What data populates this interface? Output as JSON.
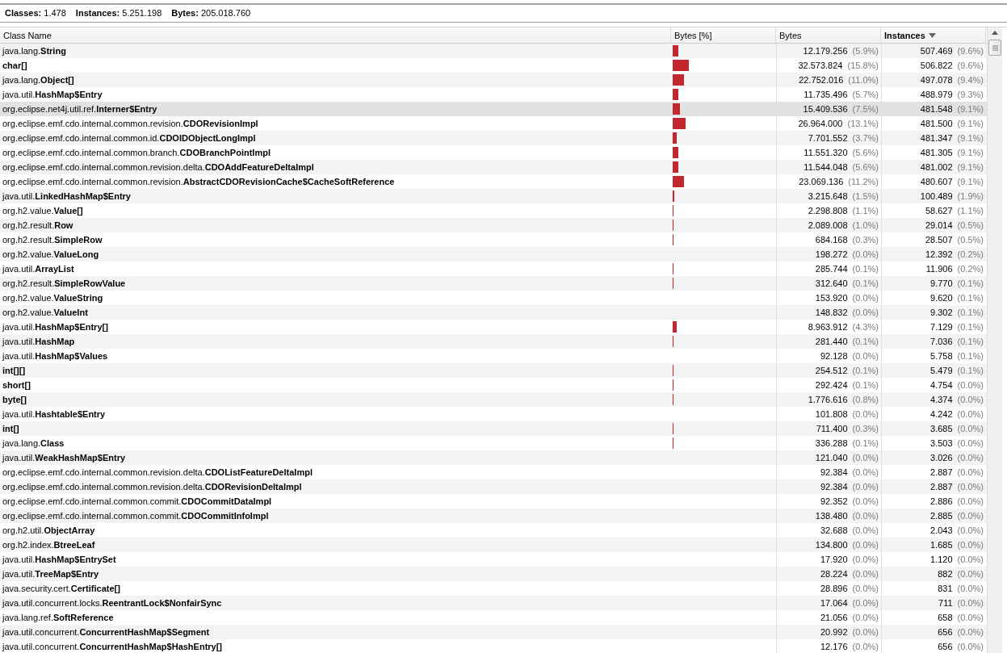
{
  "summary": [
    {
      "label": "Classes:",
      "value": "1.478"
    },
    {
      "label": "Instances:",
      "value": "5.251.198"
    },
    {
      "label": "Bytes:",
      "value": "205.018.760"
    }
  ],
  "table": {
    "columns": [
      {
        "label": "Class Name",
        "sorted": false,
        "kind": "name"
      },
      {
        "label": "Bytes [%]",
        "sorted": false,
        "kind": "bar"
      },
      {
        "label": "Bytes",
        "sorted": false,
        "kind": "bytes"
      },
      {
        "label": "Instances",
        "sorted": true,
        "kind": "instances"
      }
    ],
    "rows": [
      {
        "package": "java.lang.",
        "class": "String",
        "bytes": "12.179.256",
        "bytes_pct": "(5.9%)",
        "instances": "507.469",
        "instances_pct": "(9.6%)",
        "selected": false
      },
      {
        "package": "",
        "class": "char[]",
        "bytes": "32.573.824",
        "bytes_pct": "(15.8%)",
        "instances": "506.822",
        "instances_pct": "(9.6%)",
        "selected": false
      },
      {
        "package": "java.lang.",
        "class": "Object[]",
        "bytes": "22.752.016",
        "bytes_pct": "(11.0%)",
        "instances": "497.078",
        "instances_pct": "(9.4%)",
        "selected": false
      },
      {
        "package": "java.util.",
        "class": "HashMap$Entry",
        "bytes": "11.735.496",
        "bytes_pct": "(5.7%)",
        "instances": "488.979",
        "instances_pct": "(9.3%)",
        "selected": false
      },
      {
        "package": "org.eclipse.net4j.util.ref.",
        "class": "Interner$Entry",
        "bytes": "15.409.536",
        "bytes_pct": "(7.5%)",
        "instances": "481.548",
        "instances_pct": "(9.1%)",
        "selected": true
      },
      {
        "package": "org.eclipse.emf.cdo.internal.common.revision.",
        "class": "CDORevisionImpl",
        "bytes": "26.964.000",
        "bytes_pct": "(13.1%)",
        "instances": "481.500",
        "instances_pct": "(9.1%)",
        "selected": false
      },
      {
        "package": "org.eclipse.emf.cdo.internal.common.id.",
        "class": "CDOIDObjectLongImpl",
        "bytes": "7.701.552",
        "bytes_pct": "(3.7%)",
        "instances": "481.347",
        "instances_pct": "(9.1%)",
        "selected": false
      },
      {
        "package": "org.eclipse.emf.cdo.internal.common.branch.",
        "class": "CDOBranchPointImpl",
        "bytes": "11.551.320",
        "bytes_pct": "(5.6%)",
        "instances": "481.305",
        "instances_pct": "(9.1%)",
        "selected": false
      },
      {
        "package": "org.eclipse.emf.cdo.internal.common.revision.delta.",
        "class": "CDOAddFeatureDeltaImpl",
        "bytes": "11.544.048",
        "bytes_pct": "(5.6%)",
        "instances": "481.002",
        "instances_pct": "(9.1%)",
        "selected": false
      },
      {
        "package": "org.eclipse.emf.cdo.internal.common.revision.",
        "class": "AbstractCDORevisionCache$CacheSoftReference",
        "bytes": "23.069.136",
        "bytes_pct": "(11.2%)",
        "instances": "480.607",
        "instances_pct": "(9.1%)",
        "selected": false
      },
      {
        "package": "java.util.",
        "class": "LinkedHashMap$Entry",
        "bytes": "3.215.648",
        "bytes_pct": "(1.5%)",
        "instances": "100.489",
        "instances_pct": "(1.9%)",
        "selected": false
      },
      {
        "package": "org.h2.value.",
        "class": "Value[]",
        "bytes": "2.298.808",
        "bytes_pct": "(1.1%)",
        "instances": "58.627",
        "instances_pct": "(1.1%)",
        "selected": false
      },
      {
        "package": "org.h2.result.",
        "class": "Row",
        "bytes": "2.089.008",
        "bytes_pct": "(1.0%)",
        "instances": "29.014",
        "instances_pct": "(0.5%)",
        "selected": false
      },
      {
        "package": "org.h2.result.",
        "class": "SimpleRow",
        "bytes": "684.168",
        "bytes_pct": "(0.3%)",
        "instances": "28.507",
        "instances_pct": "(0.5%)",
        "selected": false
      },
      {
        "package": "org.h2.value.",
        "class": "ValueLong",
        "bytes": "198.272",
        "bytes_pct": "(0.0%)",
        "instances": "12.392",
        "instances_pct": "(0.2%)",
        "selected": false
      },
      {
        "package": "java.util.",
        "class": "ArrayList",
        "bytes": "285.744",
        "bytes_pct": "(0.1%)",
        "instances": "11.906",
        "instances_pct": "(0.2%)",
        "selected": false
      },
      {
        "package": "org.h2.result.",
        "class": "SimpleRowValue",
        "bytes": "312.640",
        "bytes_pct": "(0.1%)",
        "instances": "9.770",
        "instances_pct": "(0.1%)",
        "selected": false
      },
      {
        "package": "org.h2.value.",
        "class": "ValueString",
        "bytes": "153.920",
        "bytes_pct": "(0.0%)",
        "instances": "9.620",
        "instances_pct": "(0.1%)",
        "selected": false
      },
      {
        "package": "org.h2.value.",
        "class": "ValueInt",
        "bytes": "148.832",
        "bytes_pct": "(0.0%)",
        "instances": "9.302",
        "instances_pct": "(0.1%)",
        "selected": false
      },
      {
        "package": "java.util.",
        "class": "HashMap$Entry[]",
        "bytes": "8.963.912",
        "bytes_pct": "(4.3%)",
        "instances": "7.129",
        "instances_pct": "(0.1%)",
        "selected": false
      },
      {
        "package": "java.util.",
        "class": "HashMap",
        "bytes": "281.440",
        "bytes_pct": "(0.1%)",
        "instances": "7.036",
        "instances_pct": "(0.1%)",
        "selected": false
      },
      {
        "package": "java.util.",
        "class": "HashMap$Values",
        "bytes": "92.128",
        "bytes_pct": "(0.0%)",
        "instances": "5.758",
        "instances_pct": "(0.1%)",
        "selected": false
      },
      {
        "package": "",
        "class": "int[][]",
        "bytes": "254.512",
        "bytes_pct": "(0.1%)",
        "instances": "5.479",
        "instances_pct": "(0.1%)",
        "selected": false
      },
      {
        "package": "",
        "class": "short[]",
        "bytes": "292.424",
        "bytes_pct": "(0.1%)",
        "instances": "4.754",
        "instances_pct": "(0.0%)",
        "selected": false
      },
      {
        "package": "",
        "class": "byte[]",
        "bytes": "1.776.616",
        "bytes_pct": "(0.8%)",
        "instances": "4.374",
        "instances_pct": "(0.0%)",
        "selected": false
      },
      {
        "package": "java.util.",
        "class": "Hashtable$Entry",
        "bytes": "101.808",
        "bytes_pct": "(0.0%)",
        "instances": "4.242",
        "instances_pct": "(0.0%)",
        "selected": false
      },
      {
        "package": "",
        "class": "int[]",
        "bytes": "711.400",
        "bytes_pct": "(0.3%)",
        "instances": "3.685",
        "instances_pct": "(0.0%)",
        "selected": false
      },
      {
        "package": "java.lang.",
        "class": "Class",
        "bytes": "336.288",
        "bytes_pct": "(0.1%)",
        "instances": "3.503",
        "instances_pct": "(0.0%)",
        "selected": false
      },
      {
        "package": "java.util.",
        "class": "WeakHashMap$Entry",
        "bytes": "121.040",
        "bytes_pct": "(0.0%)",
        "instances": "3.026",
        "instances_pct": "(0.0%)",
        "selected": false
      },
      {
        "package": "org.eclipse.emf.cdo.internal.common.revision.delta.",
        "class": "CDOListFeatureDeltaImpl",
        "bytes": "92.384",
        "bytes_pct": "(0.0%)",
        "instances": "2.887",
        "instances_pct": "(0.0%)",
        "selected": false
      },
      {
        "package": "org.eclipse.emf.cdo.internal.common.revision.delta.",
        "class": "CDORevisionDeltaImpl",
        "bytes": "92.384",
        "bytes_pct": "(0.0%)",
        "instances": "2.887",
        "instances_pct": "(0.0%)",
        "selected": false
      },
      {
        "package": "org.eclipse.emf.cdo.internal.common.commit.",
        "class": "CDOCommitDataImpl",
        "bytes": "92.352",
        "bytes_pct": "(0.0%)",
        "instances": "2.886",
        "instances_pct": "(0.0%)",
        "selected": false
      },
      {
        "package": "org.eclipse.emf.cdo.internal.common.commit.",
        "class": "CDOCommitInfoImpl",
        "bytes": "138.480",
        "bytes_pct": "(0.0%)",
        "instances": "2.885",
        "instances_pct": "(0.0%)",
        "selected": false
      },
      {
        "package": "org.h2.util.",
        "class": "ObjectArray",
        "bytes": "32.688",
        "bytes_pct": "(0.0%)",
        "instances": "2.043",
        "instances_pct": "(0.0%)",
        "selected": false
      },
      {
        "package": "org.h2.index.",
        "class": "BtreeLeaf",
        "bytes": "134.800",
        "bytes_pct": "(0.0%)",
        "instances": "1.685",
        "instances_pct": "(0.0%)",
        "selected": false
      },
      {
        "package": "java.util.",
        "class": "HashMap$EntrySet",
        "bytes": "17.920",
        "bytes_pct": "(0.0%)",
        "instances": "1.120",
        "instances_pct": "(0.0%)",
        "selected": false
      },
      {
        "package": "java.util.",
        "class": "TreeMap$Entry",
        "bytes": "28.224",
        "bytes_pct": "(0.0%)",
        "instances": "882",
        "instances_pct": "(0.0%)",
        "selected": false
      },
      {
        "package": "java.security.cert.",
        "class": "Certificate[]",
        "bytes": "28.896",
        "bytes_pct": "(0.0%)",
        "instances": "831",
        "instances_pct": "(0.0%)",
        "selected": false
      },
      {
        "package": "java.util.concurrent.locks.",
        "class": "ReentrantLock$NonfairSync",
        "bytes": "17.064",
        "bytes_pct": "(0.0%)",
        "instances": "711",
        "instances_pct": "(0.0%)",
        "selected": false
      },
      {
        "package": "java.lang.ref.",
        "class": "SoftReference",
        "bytes": "21.056",
        "bytes_pct": "(0.0%)",
        "instances": "658",
        "instances_pct": "(0.0%)",
        "selected": false
      },
      {
        "package": "java.util.concurrent.",
        "class": "ConcurrentHashMap$Segment",
        "bytes": "20.992",
        "bytes_pct": "(0.0%)",
        "instances": "656",
        "instances_pct": "(0.0%)",
        "selected": false
      },
      {
        "package": "java.util.concurrent.",
        "class": "ConcurrentHashMap$HashEntry[]",
        "bytes": "12.176",
        "bytes_pct": "(0.0%)",
        "instances": "656",
        "instances_pct": "(0.0%)",
        "selected": false
      }
    ]
  }
}
